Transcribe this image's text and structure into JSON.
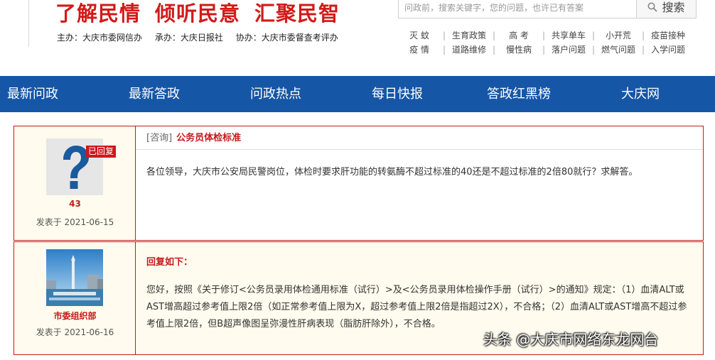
{
  "header": {
    "slogan": [
      "了解民情",
      "倾听民意",
      "汇聚民智"
    ],
    "sponsors": [
      "主办：大庆市委网信办",
      "承办：大庆日报社",
      "协办：大庆市委督查考评办"
    ],
    "search": {
      "placeholder": "问政前，搜索关键字，您的问题，也许已有答案",
      "button": "搜索"
    },
    "hot_tags": [
      [
        "灭  蚊",
        "生育政策",
        "高  考",
        "共享单车",
        "小开荒",
        "疫苗接种"
      ],
      [
        "疫  情",
        "道路维修",
        "慢性病",
        "落户问题",
        "燃气问题",
        "入学问题"
      ]
    ]
  },
  "nav": {
    "items": [
      "最新问政",
      "最新答政",
      "问政热点",
      "每日快报",
      "答政红黑榜",
      "大庆网"
    ],
    "color": "#1656a6"
  },
  "question": {
    "badge": "已回复",
    "user": "43",
    "date": "发表于  2021-06-15",
    "type": "[咨询]",
    "title": "公务员体检标准",
    "body": "各位领导，大庆市公安局民警岗位，体检时要求肝功能的转氨酶不超过标准的40还是不超过标准的2倍80就行？求解答。"
  },
  "answer": {
    "user": "市委组织部",
    "date": "发表于  2021-06-16",
    "heading": "回复如下：",
    "body": "您好，按照《关于修订<公务员录用体检通用标准（试行）>及<公务员录用体检操作手册（试行）>的通知》规定：（1）血清ALT或AST增高超过参考值上限2倍（如正常参考值上限为X，超过参考值上限2倍是指超过2X），不合格；（2）血清ALT或AST增高不超过参考值上限2倍，但B超声像图呈弥漫性肝病表现（脂肪肝除外），不合格。"
  },
  "watermark": "头条 @大庆市网络东龙网台",
  "colors": {
    "accent_red": "#c41b1b",
    "badge_red": "#d0161d",
    "answer_bg": "#fffbee"
  }
}
